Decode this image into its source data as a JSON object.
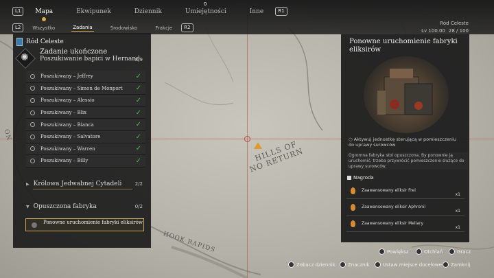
{
  "top_tabs": {
    "left_key": "L1",
    "right_key": "R1",
    "items": [
      {
        "label": "Mapa",
        "active": true
      },
      {
        "label": "Ekwipunek",
        "active": false
      },
      {
        "label": "Dziennik",
        "active": false
      },
      {
        "label": "Umiejętności",
        "active": false,
        "badge": "0"
      },
      {
        "label": "Inne",
        "active": false
      }
    ]
  },
  "sub_tabs": {
    "left_key": "L2",
    "right_key": "R2",
    "items": [
      {
        "label": "Wszystko",
        "active": false
      },
      {
        "label": "Zadania",
        "active": true
      },
      {
        "label": "Środowisko",
        "active": false
      },
      {
        "label": "Frakcje",
        "active": false
      }
    ]
  },
  "region": {
    "name": "Ród Celeste",
    "level": "Lv 100.00",
    "progress": "28 / 100"
  },
  "quest_panel": {
    "clan": "Ród Celeste",
    "status": "Zadanie ukończone",
    "title": "Poszukiwanie bapici w Hernand",
    "count": "8/9",
    "objectives": [
      {
        "label": "Poszukiwany – Jeffrey",
        "done": true
      },
      {
        "label": "Poszukiwany – Simon de Monport",
        "done": true
      },
      {
        "label": "Poszukiwany – Alessio",
        "done": true
      },
      {
        "label": "Poszukiwany – Blix",
        "done": true
      },
      {
        "label": "Poszukiwany – Bianca",
        "done": true
      },
      {
        "label": "Poszukiwany – Salvatore",
        "done": true
      },
      {
        "label": "Poszukiwany – Warren",
        "done": true
      },
      {
        "label": "Poszukiwany – Billy",
        "done": true
      }
    ],
    "sections": [
      {
        "name": "Królowa Jedwabnej Cytadeli",
        "count": "2/2"
      },
      {
        "name": "Opuszczona fabryka",
        "count": "0/2"
      }
    ],
    "selected_quest": "Ponowne uruchomienie fabryki eliksirów"
  },
  "detail_panel": {
    "title": "Ponowne uruchomienie fabryki eliksirów",
    "objective": "Aktywuj jednostkę sterującą w pomieszczeniu do uprawy surowców",
    "description": "Ogromna fabryka stoi opuszczona. By ponownie ją uruchomić, trzeba przywrócić pomieszczenie służące do uprawy surowców.",
    "reward_heading": "Nagroda",
    "rewards": [
      {
        "name": "Zaawansowany eliksir Frei",
        "qty": "x1"
      },
      {
        "name": "Zaawansowany eliksir Aphronii",
        "qty": "x1"
      },
      {
        "name": "Zaawansowany eliksir Meliary",
        "qty": "x1"
      }
    ]
  },
  "map_labels": {
    "hills": "HILLS OF",
    "hills2": "NO RETURN",
    "hook": "HOOK RAPIDS",
    "side": "ON"
  },
  "hints_top": [
    {
      "label": "Powiększ"
    },
    {
      "label": "Otchłań"
    },
    {
      "label": "Gracz"
    }
  ],
  "hints_bottom": [
    {
      "label": "Zobacz dziennik"
    },
    {
      "label": "Znacznik"
    },
    {
      "label": "Ustaw miejsce docelowe"
    },
    {
      "label": "Zamknij"
    }
  ],
  "colors": {
    "accent": "#d9a84a",
    "done": "#4dbf4d",
    "crosshair": "#b0503c"
  }
}
